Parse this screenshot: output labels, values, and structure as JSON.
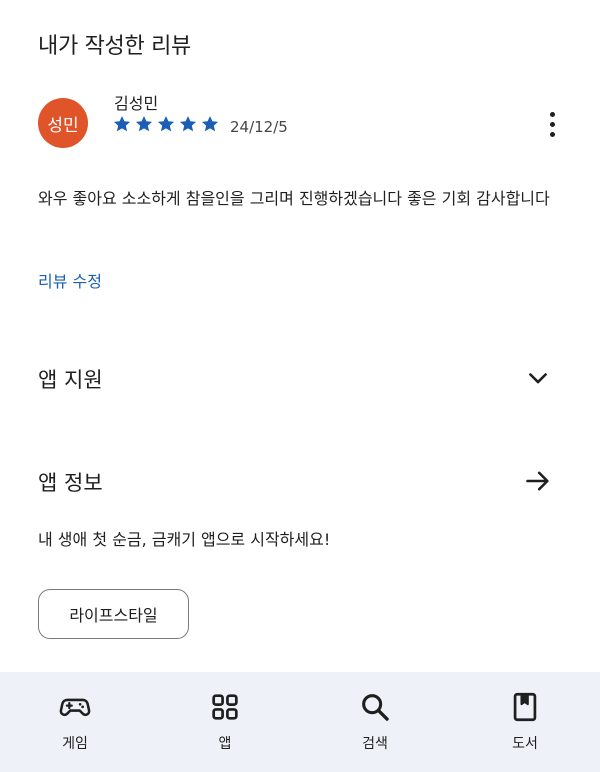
{
  "my_review": {
    "section_title": "내가 작성한 리뷰",
    "avatar_text": "성민",
    "avatar_color": "#e0542a",
    "reviewer_name": "김성민",
    "rating": 5,
    "rating_max": 5,
    "star_color": "#1a5fb4",
    "date": "24/12/5",
    "more_icon": "more-vert-icon",
    "body": "와우 좋아요 소소하게 참을인을 그리며 진행하겠습니다 좋은 기회 감사합니다",
    "edit_label": "리뷰 수정"
  },
  "app_support": {
    "title": "앱 지원",
    "icon": "chevron-down-icon"
  },
  "app_info": {
    "title": "앱 정보",
    "icon": "arrow-right-icon",
    "tagline": "내 생애 첫 순금, 금캐기 앱으로 시작하세요!",
    "category_chip": "라이프스타일"
  },
  "bottom_nav": {
    "background": "#eef2f8",
    "items": [
      {
        "label": "게임",
        "icon": "gamepad-icon"
      },
      {
        "label": "앱",
        "icon": "apps-grid-icon"
      },
      {
        "label": "검색",
        "icon": "search-icon"
      },
      {
        "label": "도서",
        "icon": "book-icon"
      }
    ]
  }
}
